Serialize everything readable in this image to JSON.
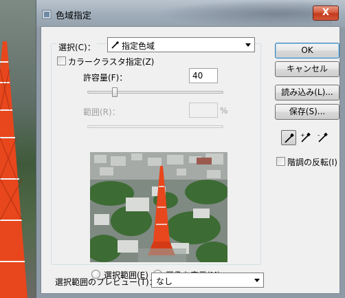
{
  "dialog": {
    "title": "色域指定",
    "close_label": "X"
  },
  "selection": {
    "label": "選択(C)：",
    "value": "指定色域"
  },
  "cluster": {
    "label": "カラークラスタ指定(Z)",
    "checked": false
  },
  "tolerance": {
    "label": "許容量(F)：",
    "value": "40"
  },
  "range": {
    "label": "範囲(R)：",
    "value": "",
    "unit": "%"
  },
  "view_mode": {
    "selection_label": "選択範囲(E)",
    "image_label": "画像を表示(M)",
    "selected": "image"
  },
  "preview_mode": {
    "label": "選択範囲のプレビュー(T)：",
    "value": "なし"
  },
  "buttons": {
    "ok": "OK",
    "cancel": "キャンセル",
    "load": "読み込み(L)...",
    "save": "保存(S)..."
  },
  "eyedroppers": [
    "eyedropper-icon",
    "eyedropper-plus-icon",
    "eyedropper-minus-icon"
  ],
  "invert": {
    "label": "階調の反転(I)",
    "checked": false
  },
  "colors": {
    "tower": "#e8461c",
    "foliage": "#3d6b34",
    "default_button_border": "#3c7fb1"
  }
}
